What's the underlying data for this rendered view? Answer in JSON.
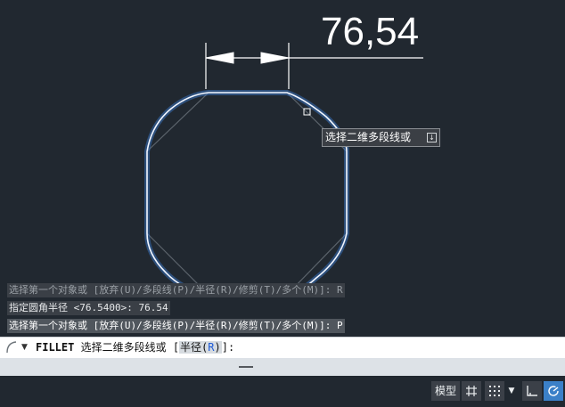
{
  "drawing": {
    "dimension_value": "76,54",
    "tooltip": {
      "text": "选择二维多段线或",
      "icon": "down-arrow-icon"
    }
  },
  "command_history": [
    "选择第一个对象或 [放弃(U)/多段线(P)/半径(R)/修剪(T)/多个(M)]: R",
    "指定圆角半径 <76.5400>: 76.54",
    "选择第一个对象或 [放弃(U)/多段线(P)/半径(R)/修剪(T)/多个(M)]: P"
  ],
  "command_line": {
    "command": "FILLET",
    "prompt": "选择二维多段线或 [",
    "option_label": "半径(",
    "option_key": "R",
    "option_close": ")",
    "suffix": "]:"
  },
  "status_bar": {
    "model_label": "模型",
    "active_color": "#3b80c8",
    "icons": [
      "grid-icon",
      "snap-icon",
      "dropdown-icon",
      "ortho-icon",
      "polar-tracking-icon"
    ]
  }
}
